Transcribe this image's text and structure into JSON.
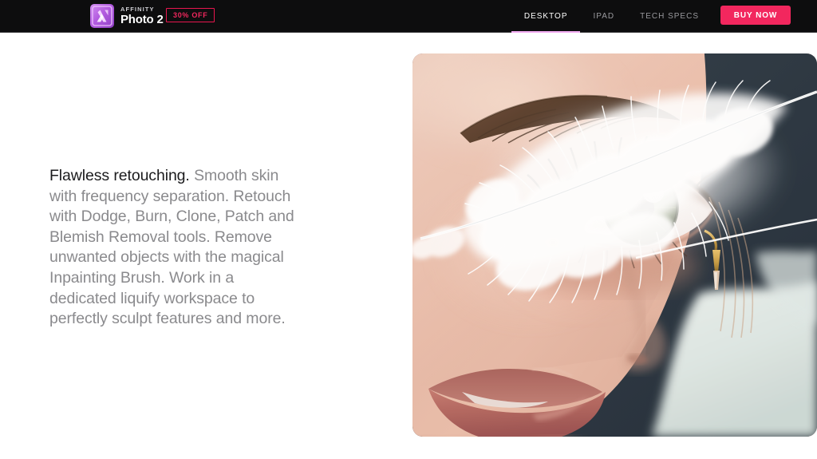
{
  "header": {
    "brand": {
      "logo_icon": "affinity-photo-logo-icon",
      "kicker": "AFFINITY",
      "name": "Photo 2"
    },
    "promo_badge": "30% OFF",
    "nav_items": [
      {
        "label": "DESKTOP",
        "active": true
      },
      {
        "label": "IPAD",
        "active": false
      },
      {
        "label": "TECH SPECS",
        "active": false
      }
    ],
    "cta_label": "BUY NOW",
    "colors": {
      "background": "#0d0d0e",
      "accent_pink": "#f2275e",
      "active_underline": "#f0aaf0",
      "nav_inactive": "#9a9a9e"
    }
  },
  "main": {
    "feature": {
      "lead": "Flawless retouching.",
      "body": " Smooth skin with frequency separation. Retouch with Dodge, Burn, Clone, Patch and Blemish Removal tools. Remove unwanted objects with the magical Inpainting Brush. Work in a dedicated liquify workspace to perfectly sculpt features and more."
    },
    "hero_image": {
      "alt": "Close-up portrait of a woman's face with a white feather held across her cheek, green eye and gold earring visible"
    }
  }
}
